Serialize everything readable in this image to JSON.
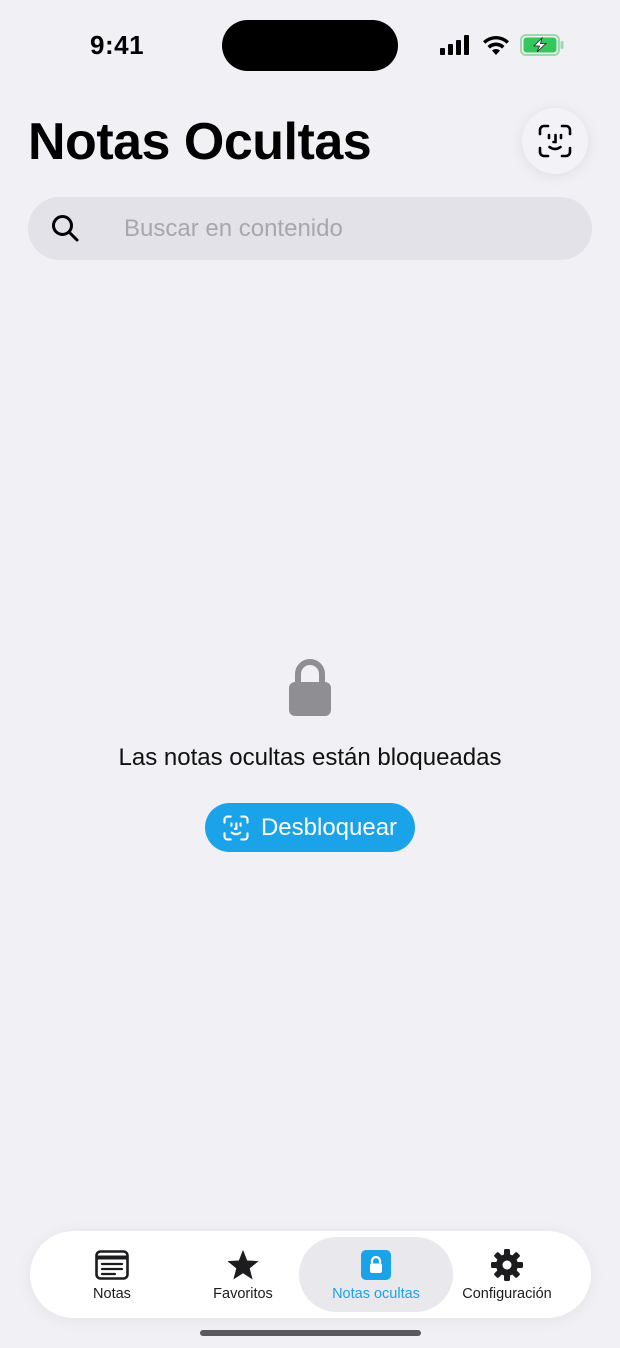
{
  "status_bar": {
    "time": "9:41"
  },
  "header": {
    "title": "Notas Ocultas",
    "faceid_icon": "faceid-icon"
  },
  "search": {
    "placeholder": "Buscar en contenido",
    "value": ""
  },
  "locked_state": {
    "message": "Las notas ocultas están bloqueadas",
    "unlock_label": "Desbloquear"
  },
  "tab_bar": {
    "tabs": [
      {
        "label": "Notas",
        "icon": "notes-icon"
      },
      {
        "label": "Favoritos",
        "icon": "star-icon"
      },
      {
        "label": "Notas ocultas",
        "icon": "lock-icon"
      },
      {
        "label": "Configuración",
        "icon": "gear-icon"
      }
    ],
    "active_index": 2
  },
  "colors": {
    "accent": "#1aa3e8",
    "background": "#f0f0f5",
    "search_bg": "#e2e2e8",
    "battery_green": "#34c759"
  }
}
